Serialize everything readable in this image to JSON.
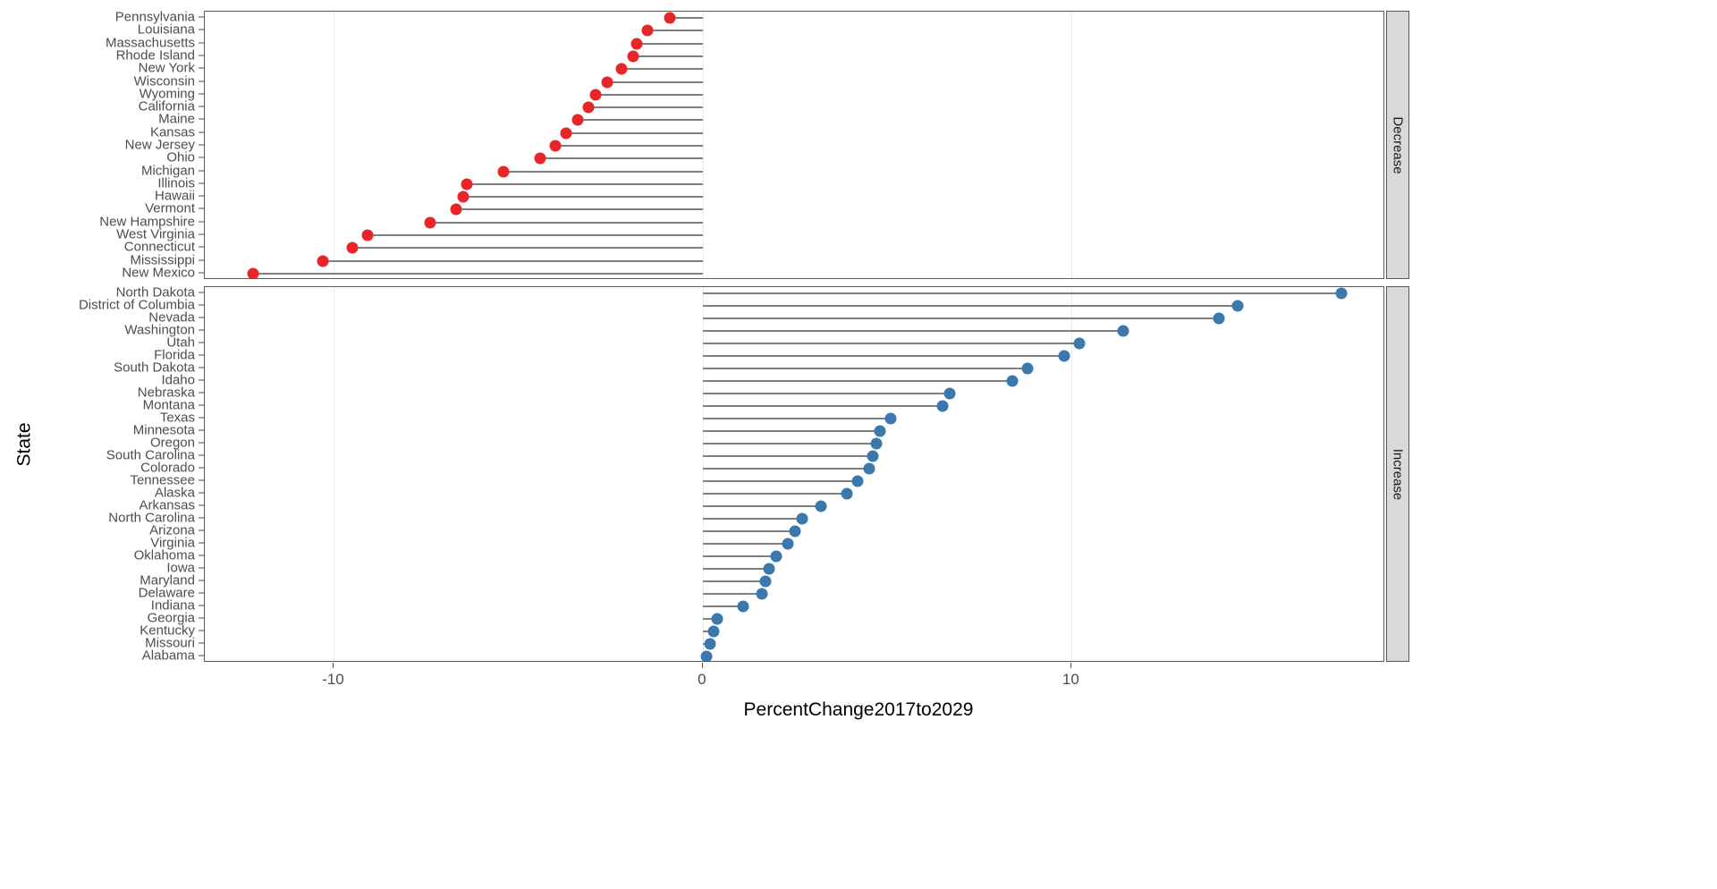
{
  "chart_data": {
    "type": "scatter",
    "subtype": "lollipop-dot-plot",
    "title": "",
    "xlabel": "PercentChange2017to2029",
    "ylabel": "State",
    "xlim": [
      -13.5,
      18.5
    ],
    "xticks": [
      -10,
      0,
      10
    ],
    "xtick_labels": [
      "-10",
      "0",
      "10"
    ],
    "grid": "vertical-only",
    "legend": "none",
    "facets": [
      {
        "strip_label": "Decrease",
        "color": "#e8262a",
        "categories": [
          "Pennsylvania",
          "Louisiana",
          "Massachusetts",
          "Rhode Island",
          "New York",
          "Wisconsin",
          "Wyoming",
          "California",
          "Maine",
          "Kansas",
          "New Jersey",
          "Ohio",
          "Michigan",
          "Illinois",
          "Hawaii",
          "Vermont",
          "New Hampshire",
          "West Virginia",
          "Connecticut",
          "Mississippi",
          "New Mexico"
        ],
        "values": [
          -0.9,
          -1.5,
          -1.8,
          -1.9,
          -2.2,
          -2.6,
          -2.9,
          -3.1,
          -3.4,
          -3.7,
          -4.0,
          -4.4,
          -5.4,
          -6.4,
          -6.5,
          -6.7,
          -7.4,
          -9.1,
          -9.5,
          -10.3,
          -12.2
        ]
      },
      {
        "strip_label": "Increase",
        "color": "#3a78ae",
        "categories": [
          "North Dakota",
          "District of Columbia",
          "Nevada",
          "Washington",
          "Utah",
          "Florida",
          "South Dakota",
          "Idaho",
          "Nebraska",
          "Montana",
          "Texas",
          "Minnesota",
          "Oregon",
          "South Carolina",
          "Colorado",
          "Tennessee",
          "Alaska",
          "Arkansas",
          "North Carolina",
          "Arizona",
          "Virginia",
          "Oklahoma",
          "Iowa",
          "Maryland",
          "Delaware",
          "Indiana",
          "Georgia",
          "Kentucky",
          "Missouri",
          "Alabama"
        ],
        "values": [
          17.3,
          14.5,
          14.0,
          11.4,
          10.2,
          9.8,
          8.8,
          8.4,
          6.7,
          6.5,
          5.1,
          4.8,
          4.7,
          4.6,
          4.5,
          4.2,
          3.9,
          3.2,
          2.7,
          2.5,
          2.3,
          2.0,
          1.8,
          1.7,
          1.6,
          1.1,
          0.4,
          0.3,
          0.2,
          0.1
        ]
      }
    ]
  }
}
